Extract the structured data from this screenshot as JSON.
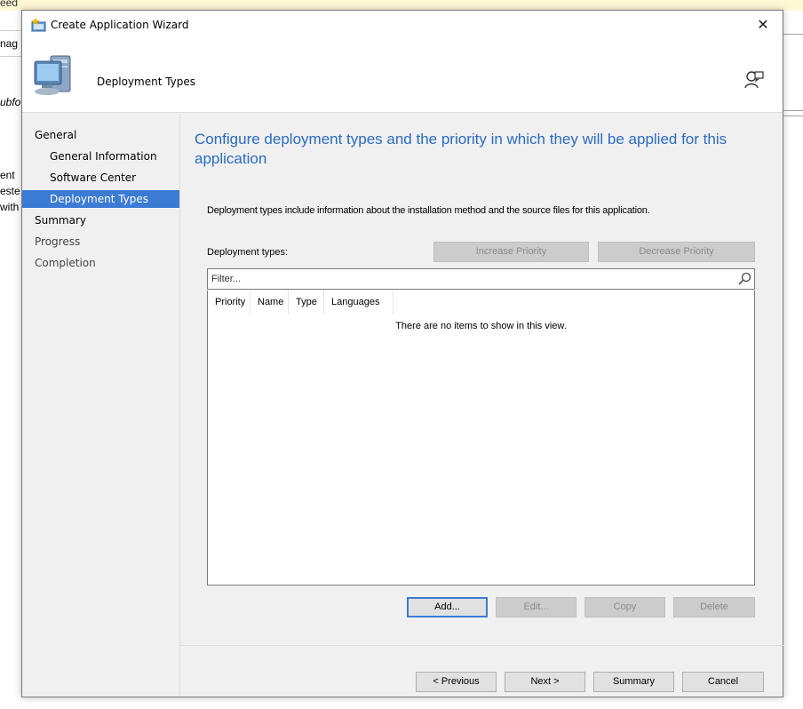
{
  "background": {
    "topbar_text_left": "eed",
    "topbar_text_right": "",
    "fragments": [
      "nag",
      "ubfo",
      "ent",
      "este",
      "with"
    ]
  },
  "window": {
    "title": "Create Application Wizard",
    "close_glyph": "✕"
  },
  "header": {
    "title": "Deployment Types"
  },
  "nav": {
    "items": [
      {
        "label": "General",
        "state": "done"
      },
      {
        "label": "General Information",
        "state": "done"
      },
      {
        "label": "Software Center",
        "state": "done"
      },
      {
        "label": "Deployment Types",
        "state": "active"
      },
      {
        "label": "Summary",
        "state": "pending"
      },
      {
        "label": "Progress",
        "state": "pending"
      },
      {
        "label": "Completion",
        "state": "pending"
      }
    ]
  },
  "main": {
    "heading": "Configure deployment types and the priority in which they will be applied for this application",
    "description": "Deployment types include information about the installation method and the source files for this application.",
    "deployment_types_label": "Deployment types:",
    "increase_priority": "Increase Priority",
    "decrease_priority": "Decrease Priority",
    "filter_placeholder": "Filter...",
    "columns": [
      "Priority",
      "Name",
      "Type",
      "Languages"
    ],
    "empty_message": "There are no items to show in this view.",
    "add": "Add...",
    "edit": "Edit...",
    "copy": "Copy",
    "delete": "Delete"
  },
  "footer": {
    "previous": "< Previous",
    "next": "Next >",
    "summary": "Summary",
    "cancel": "Cancel"
  },
  "colors": {
    "accent": "#3b7bd4",
    "heading": "#2a6bc4",
    "dialog_bg": "#f0f0f0"
  },
  "icons": [
    "wizard-title-icon",
    "computer-icon",
    "help-person-icon",
    "search-icon",
    "close-icon"
  ]
}
